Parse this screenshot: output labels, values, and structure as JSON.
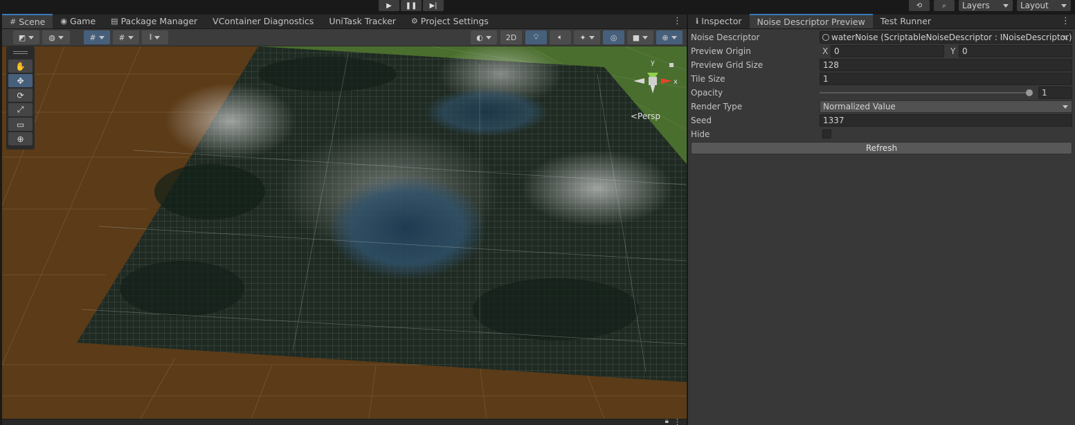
{
  "play_controls": {
    "play_icon": "play-icon",
    "pause_icon": "pause-icon",
    "step_icon": "step-icon",
    "play": "▶",
    "pause": "❚❚",
    "step": "▶|"
  },
  "topbar": {
    "history": "⟲",
    "search": "⌕",
    "layers_label": "Layers",
    "layout_label": "Layout"
  },
  "scene_tabs": [
    {
      "label": "Scene",
      "glyph": "#"
    },
    {
      "label": "Game",
      "glyph": "◉"
    },
    {
      "label": "Package Manager",
      "glyph": "▤"
    },
    {
      "label": "VContainer Diagnostics",
      "glyph": ""
    },
    {
      "label": "UniTask Tracker",
      "glyph": ""
    },
    {
      "label": "Project Settings",
      "glyph": "⚙"
    }
  ],
  "scene_toolbar": {
    "two_d": "2D"
  },
  "tools": [
    {
      "name": "hand-tool",
      "glyph": "✋"
    },
    {
      "name": "move-tool",
      "glyph": "✥"
    },
    {
      "name": "rotate-tool",
      "glyph": "⟳"
    },
    {
      "name": "scale-tool",
      "glyph": "⤢"
    },
    {
      "name": "rect-tool",
      "glyph": "▭"
    },
    {
      "name": "transform-tool",
      "glyph": "⊕"
    }
  ],
  "gizmo": {
    "y": "y",
    "x": "x",
    "persp": "<Persp"
  },
  "right_tabs": [
    {
      "label": "Inspector",
      "glyph": "ℹ"
    },
    {
      "label": "Noise Descriptor Preview",
      "glyph": ""
    },
    {
      "label": "Test Runner",
      "glyph": ""
    }
  ],
  "inspector": {
    "noise_descriptor_label": "Noise Descriptor",
    "noise_descriptor_value": "waterNoise (ScriptableNoiseDescriptor : INoiseDescriptor)",
    "preview_origin_label": "Preview Origin",
    "origin_x_label": "X",
    "origin_x": "0",
    "origin_y_label": "Y",
    "origin_y": "0",
    "grid_size_label": "Preview Grid Size",
    "grid_size": "128",
    "tile_size_label": "Tile Size",
    "tile_size": "1",
    "opacity_label": "Opacity",
    "opacity": "1",
    "opacity_fraction": 1.0,
    "render_type_label": "Render Type",
    "render_type": "Normalized Value",
    "seed_label": "Seed",
    "seed": "1337",
    "hide_label": "Hide",
    "hide_checked": false,
    "refresh_label": "Refresh"
  },
  "colors": {
    "accent": "#3a79bb",
    "terrain_brown": "#5b3b18",
    "terrain_green": "#4a6e2e",
    "grid_dark": "#1f2a22",
    "water": "#2f5068"
  }
}
